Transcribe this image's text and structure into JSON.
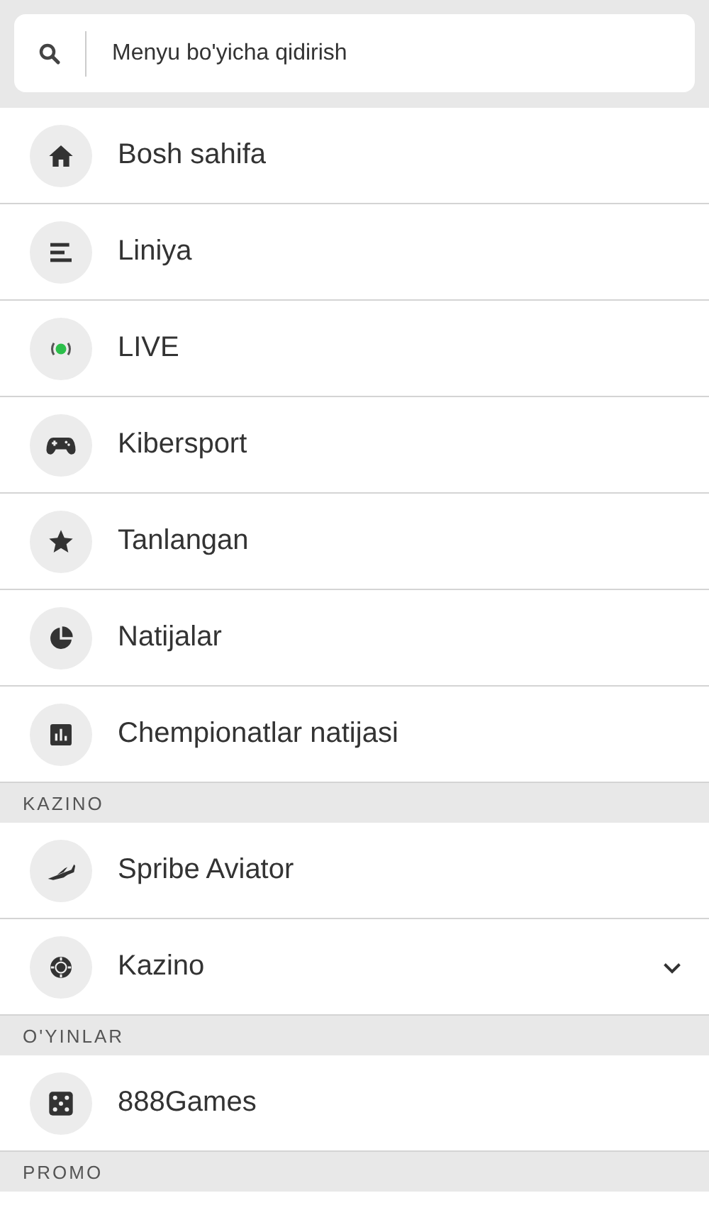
{
  "search": {
    "placeholder": "Menyu bo'yicha qidirish"
  },
  "sections": [
    {
      "items": [
        {
          "label": "Bosh sahifa",
          "kind": "home",
          "has_submenu": false
        },
        {
          "label": "Liniya",
          "kind": "lines",
          "has_submenu": false
        },
        {
          "label": "LIVE",
          "kind": "live",
          "has_submenu": false
        },
        {
          "label": "Kibersport",
          "kind": "gamepad",
          "has_submenu": false
        },
        {
          "label": "Tanlangan",
          "kind": "star",
          "has_submenu": false
        },
        {
          "label": "Natijalar",
          "kind": "pie",
          "has_submenu": false
        },
        {
          "label": "Chempionatlar natijasi",
          "kind": "chart",
          "has_submenu": false
        }
      ]
    },
    {
      "header": "KAZINO",
      "items": [
        {
          "label": "Spribe Aviator",
          "kind": "plane",
          "has_submenu": false
        },
        {
          "label": "Kazino",
          "kind": "chip",
          "has_submenu": true
        }
      ]
    },
    {
      "header": "O'YINLAR",
      "items": [
        {
          "label": "888Games",
          "kind": "dice",
          "has_submenu": false
        }
      ]
    },
    {
      "header": "PROMO"
    }
  ]
}
